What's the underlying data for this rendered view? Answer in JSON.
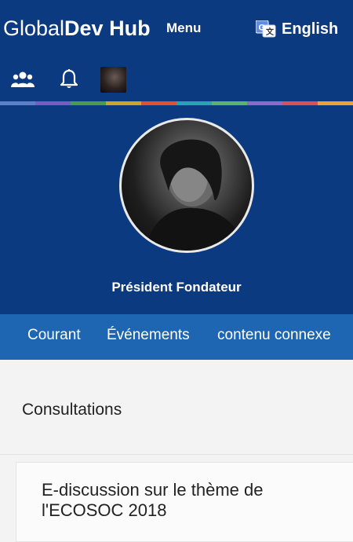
{
  "header": {
    "brand_light": "Global",
    "brand_bold": "Dev Hub",
    "menu_label": "Menu",
    "language_label": "English",
    "icons": [
      "users-icon",
      "bell-icon",
      "profile-avatar"
    ]
  },
  "stripe_colors": [
    "#5c7fc9",
    "#7c5ac4",
    "#4c9b4c",
    "#d2a223",
    "#e0522f",
    "#27a3b6",
    "#5bb46a",
    "#8d6ac9",
    "#d94f5a",
    "#f0a030"
  ],
  "profile": {
    "role": "Président Fondateur"
  },
  "tabs": [
    {
      "label": "Courant"
    },
    {
      "label": "Événements"
    },
    {
      "label": "contenu connexe"
    }
  ],
  "content": {
    "section_title": "Consultations",
    "card_title": "E-discussion sur le thème de l'ECOSOC 2018"
  },
  "colors": {
    "header_bg": "#0c3a80",
    "tabs_bg": "#1f66b2",
    "page_bg": "#f3f3f3"
  }
}
